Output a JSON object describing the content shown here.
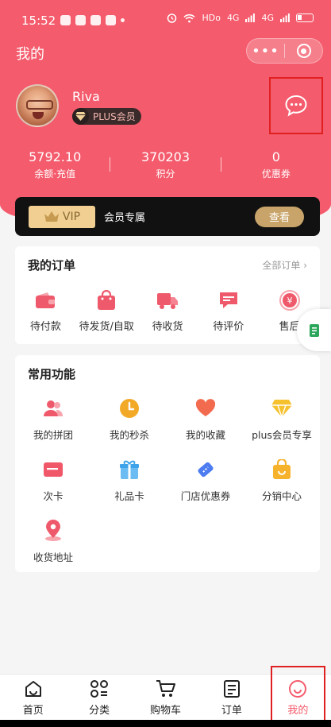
{
  "status_bar": {
    "time": "15:52",
    "icons": [
      "wechat-icon",
      "app-icon",
      "telegram-icon",
      "mail-icon",
      "dot-icon",
      "alarm-icon",
      "wifi-icon",
      "signal-icon",
      "battery-icon"
    ],
    "hd": "HDo",
    "net1": "4G",
    "net2": "4G"
  },
  "nav": {
    "title": "我的",
    "more_label": "•••"
  },
  "profile": {
    "username": "Riva",
    "badge": "PLUS会员"
  },
  "stats": [
    {
      "value": "5792.10",
      "label": "余额·充值"
    },
    {
      "value": "370203",
      "label": "积分"
    },
    {
      "value": "0",
      "label": "优惠券"
    }
  ],
  "vip": {
    "tag": "VIP",
    "text": "会员专属",
    "button": "查看"
  },
  "orders": {
    "title": "我的订单",
    "all_link": "全部订单 ›",
    "items": [
      {
        "label": "待付款",
        "icon": "wallet-icon"
      },
      {
        "label": "待发货/自取",
        "icon": "bag-icon"
      },
      {
        "label": "待收货",
        "icon": "truck-icon"
      },
      {
        "label": "待评价",
        "icon": "comment-icon"
      },
      {
        "label": "售后",
        "icon": "refund-icon"
      }
    ]
  },
  "features": {
    "title": "常用功能",
    "items": [
      {
        "label": "我的拼团",
        "icon": "group-icon"
      },
      {
        "label": "我的秒杀",
        "icon": "clock-icon"
      },
      {
        "label": "我的收藏",
        "icon": "heart-icon"
      },
      {
        "label": "plus会员专享",
        "icon": "diamond-icon"
      },
      {
        "label": "次卡",
        "icon": "card-icon"
      },
      {
        "label": "礼品卡",
        "icon": "gift-icon"
      },
      {
        "label": "门店优惠券",
        "icon": "coupon-icon"
      },
      {
        "label": "分销中心",
        "icon": "bag-smile-icon"
      },
      {
        "label": "收货地址",
        "icon": "location-icon"
      }
    ]
  },
  "tabbar": {
    "items": [
      {
        "label": "首页",
        "icon": "home-icon"
      },
      {
        "label": "分类",
        "icon": "category-icon"
      },
      {
        "label": "购物车",
        "icon": "cart-icon"
      },
      {
        "label": "订单",
        "icon": "order-icon"
      },
      {
        "label": "我的",
        "icon": "profile-icon"
      }
    ],
    "active_index": 4
  },
  "colors": {
    "primary": "#f45b6c",
    "vip_gold": "#c8a46a",
    "highlight_box": "#e02020"
  }
}
